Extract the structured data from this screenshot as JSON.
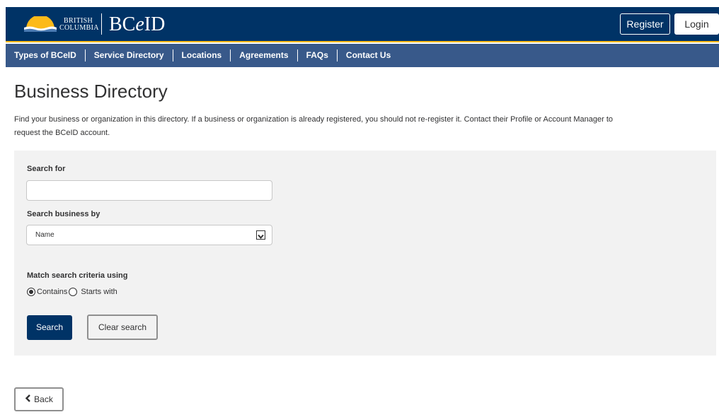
{
  "header": {
    "bc_line1": "BRITISH",
    "bc_line2": "COLUMBIA",
    "product_prefix": "BC",
    "product_e": "e",
    "product_suffix": "ID",
    "register_label": "Register",
    "login_label": "Login",
    "colors": {
      "primary": "#003366",
      "gold": "#fcba19"
    }
  },
  "nav": {
    "items": [
      {
        "label": "Types of BCeID"
      },
      {
        "label": "Service Directory"
      },
      {
        "label": "Locations"
      },
      {
        "label": "Agreements"
      },
      {
        "label": "FAQs"
      },
      {
        "label": "Contact Us"
      }
    ],
    "color": "#38598a"
  },
  "page": {
    "title": "Business Directory",
    "intro_line1": "Find your business or organization in this directory. If a business or organization is already registered, you should not re-register it. Contact their Profile or Account Manager to",
    "intro_line2": "request the BCeID account."
  },
  "search_form": {
    "search_for_label": "Search for",
    "search_for_value": "",
    "search_by_label": "Search business by",
    "search_by_value": "Name",
    "match_label": "Match search criteria using",
    "match_options": [
      {
        "label": "Contains",
        "checked": true
      },
      {
        "label": "Starts with",
        "checked": false
      }
    ],
    "search_button": "Search",
    "clear_button": "Clear search"
  },
  "footer": {
    "back_button": "Back",
    "back_icon": "chevron-left-icon"
  }
}
